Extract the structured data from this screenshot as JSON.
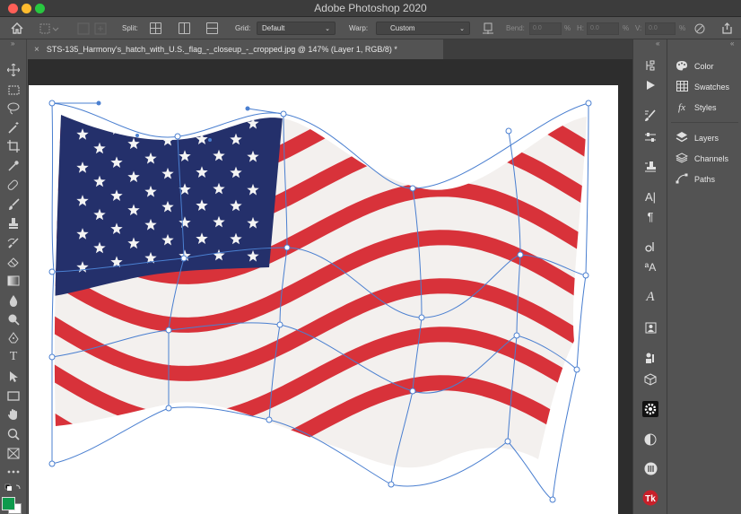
{
  "window": {
    "title": "Adobe Photoshop 2020"
  },
  "options_bar": {
    "split_label": "Split:",
    "grid_label": "Grid:",
    "grid_value": "Default",
    "warp_label": "Warp:",
    "warp_value": "Custom",
    "bend_label": "Bend:",
    "bend_value": "0.0",
    "h_label": "H:",
    "h_value": "0.0",
    "v_label": "V:",
    "v_value": "0.0",
    "percent": "%"
  },
  "document_tab": {
    "close": "×",
    "title": "STS-135_Harmony's_hatch_with_U.S._flag_-_closeup_-_cropped.jpg @ 147% (Layer 1, RGB/8) *"
  },
  "panels": [
    {
      "label": "Color",
      "icon": "palette-icon"
    },
    {
      "label": "Swatches",
      "icon": "grid-icon"
    },
    {
      "label": "Styles",
      "icon": "fx-icon"
    },
    {
      "label": "Layers",
      "icon": "layers-icon"
    },
    {
      "label": "Channels",
      "icon": "channels-icon"
    },
    {
      "label": "Paths",
      "icon": "paths-icon"
    }
  ],
  "colors": {
    "foreground": "#0e9a4c",
    "background": "#ffffff",
    "flag_red": "#d8323a",
    "flag_white": "#f3f0ee",
    "flag_blue": "#24306b",
    "warp_grid": "#4a7fd0"
  }
}
